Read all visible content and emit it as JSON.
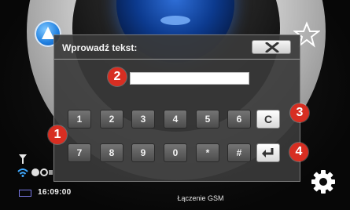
{
  "dialog": {
    "title": "Wprowadź tekst:",
    "close_icon": "close-x-icon",
    "text_value": ""
  },
  "keypad": {
    "row1": [
      "1",
      "2",
      "3",
      "4",
      "5",
      "6",
      "C"
    ],
    "row2": [
      "7",
      "8",
      "9",
      "0",
      "*",
      "#"
    ],
    "enter_icon": "enter-return-icon"
  },
  "markers": [
    "1",
    "2",
    "3",
    "4"
  ],
  "status_bar": {
    "time": "16:09:00",
    "network_text": "Łączenie GSM",
    "icons": [
      "antenna-icon",
      "wifi-icon",
      "connection-icon",
      "battery-icon"
    ]
  },
  "background_buttons": [
    "navigation-icon",
    "favorite-star-icon",
    "settings-gear-icon"
  ],
  "colors": {
    "marker": "#d72e22",
    "dialog": "#3a3a3a",
    "accent_blue": "#1f7fe0"
  }
}
